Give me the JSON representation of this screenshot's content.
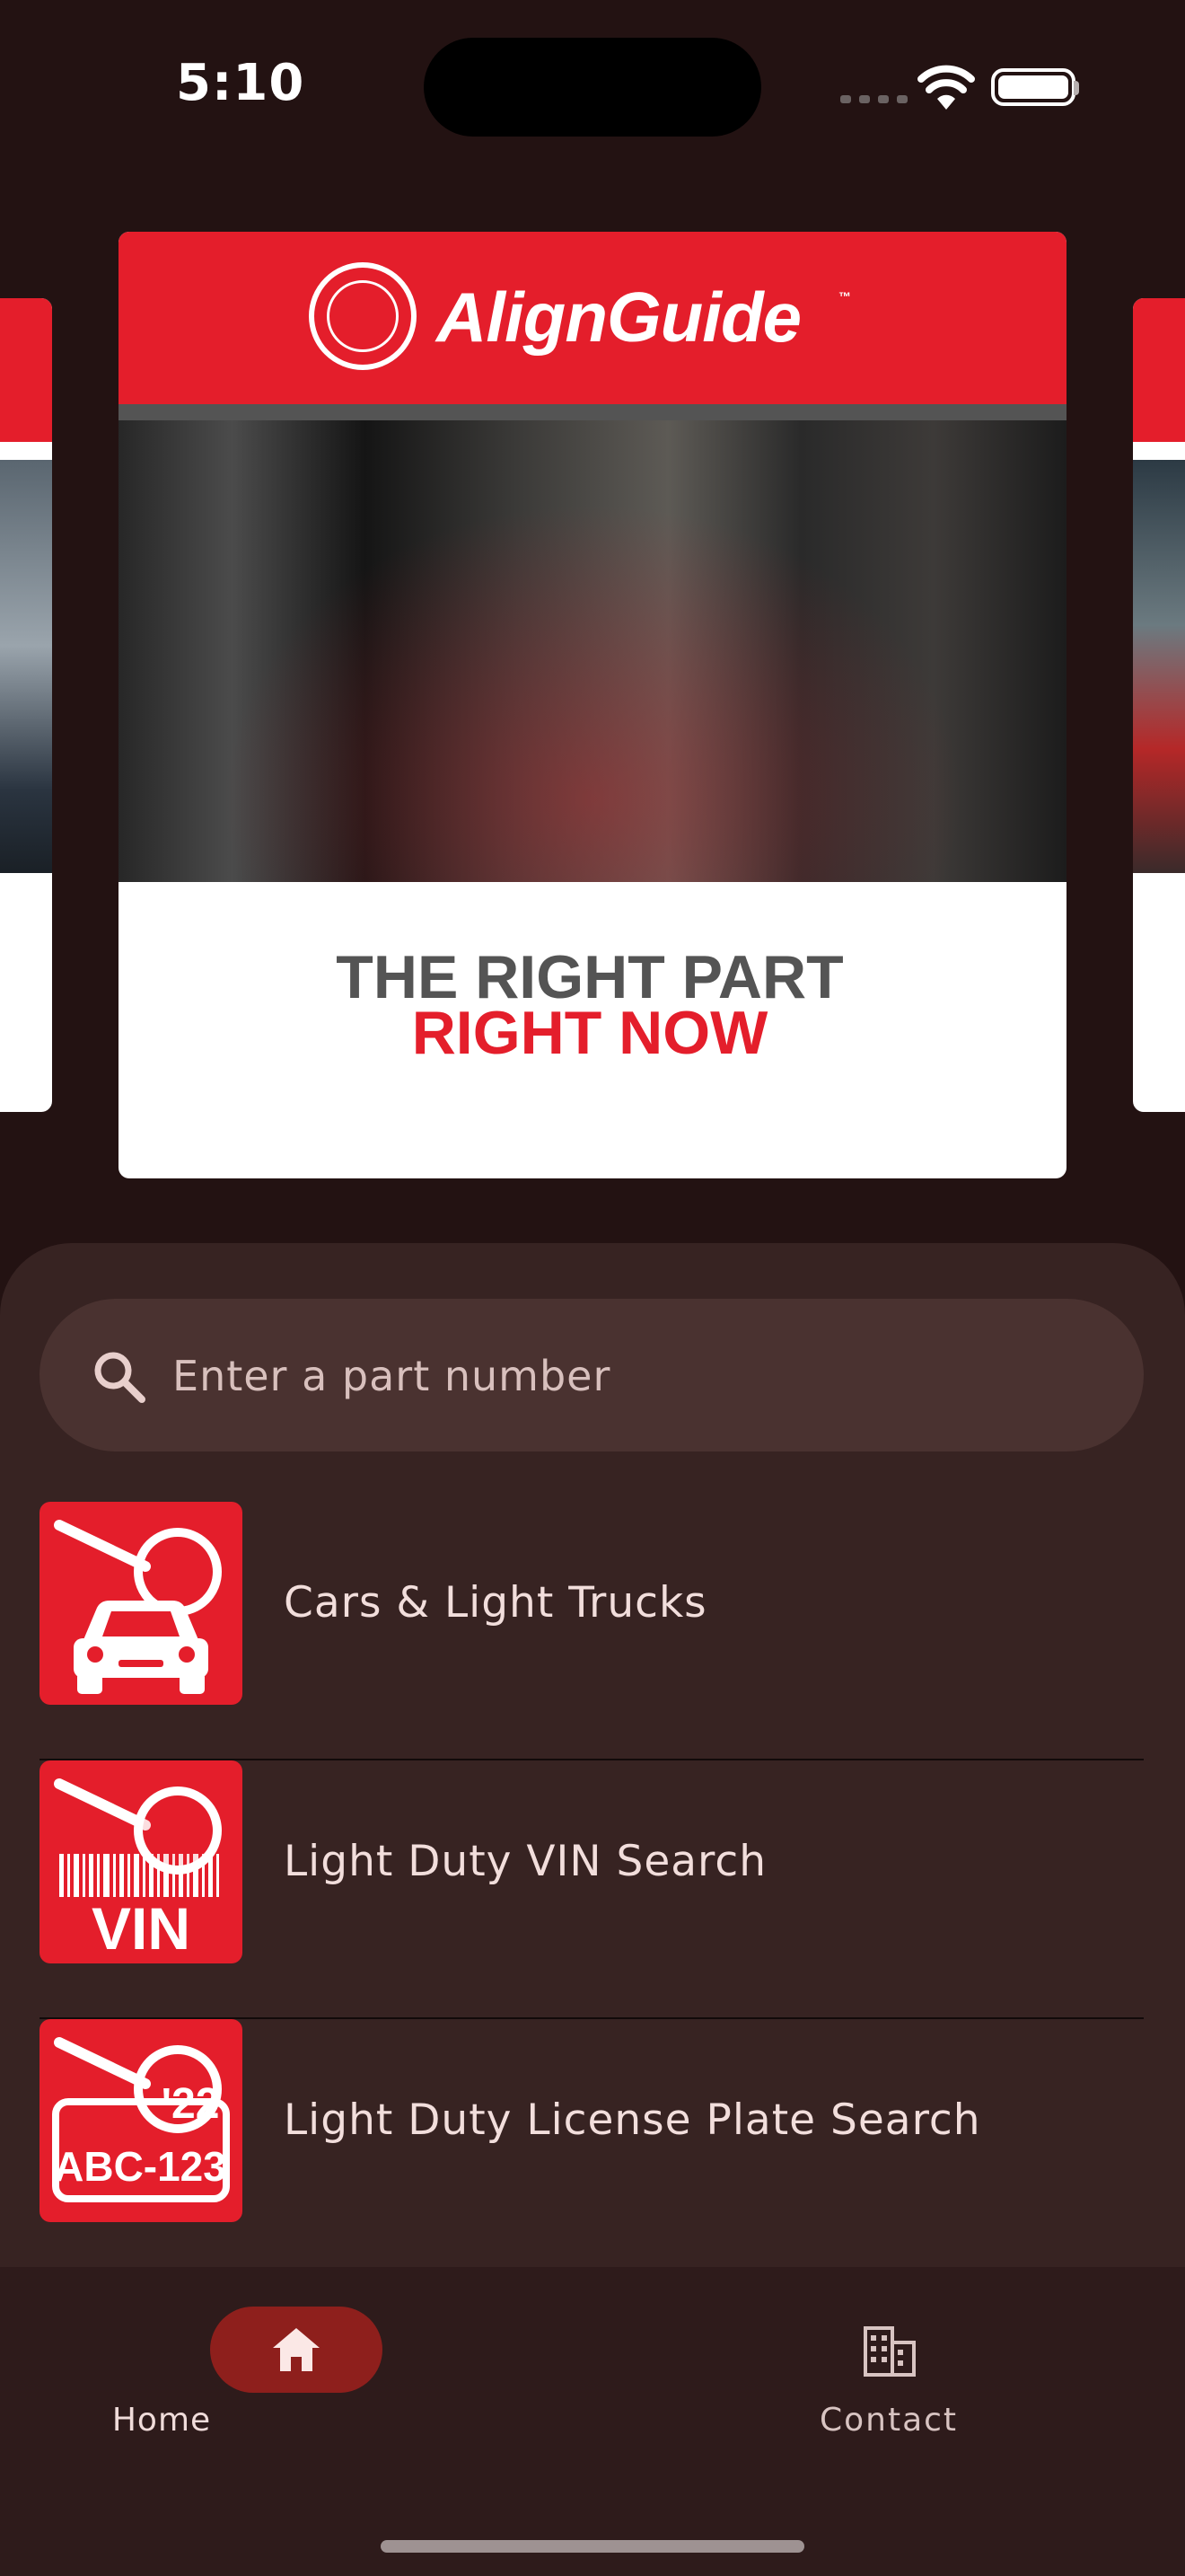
{
  "status_bar": {
    "time": "5:10"
  },
  "carousel": {
    "brand": "AlignGuide",
    "trademark": "™",
    "tagline_line1": "THE RIGHT PART",
    "tagline_line2": "RIGHT NOW"
  },
  "search": {
    "placeholder": "Enter a part number"
  },
  "list": {
    "items": [
      {
        "label": "Cars & Light Trucks",
        "icon": "car-search-icon"
      },
      {
        "label": "Light Duty VIN Search",
        "icon": "vin-search-icon",
        "tile_text": "VIN"
      },
      {
        "label": "Light Duty License Plate Search",
        "icon": "license-plate-search-icon",
        "tile_text": "ABC-123",
        "tile_year": "'22"
      }
    ]
  },
  "bottom_nav": {
    "home_label": "Home",
    "contact_label": "Contact",
    "active": "Home"
  },
  "colors": {
    "accent_red": "#e41e2b",
    "background": "#231212",
    "sheet": "#372322",
    "active_pill": "#8e1f1c"
  }
}
